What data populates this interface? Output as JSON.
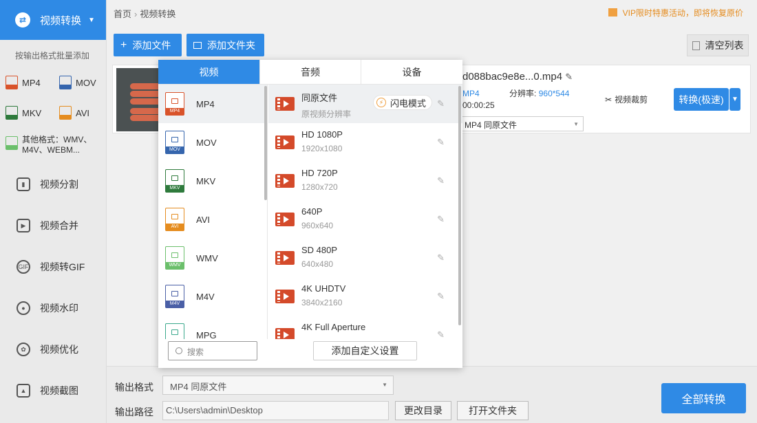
{
  "sidebar": {
    "header": "视频转换",
    "subtitle": "按输出格式批量添加",
    "formats": [
      "MP4",
      "MOV",
      "MKV",
      "AVI"
    ],
    "format_colors": [
      "#d9532a",
      "#3565ad",
      "#2e7a3c",
      "#e58c1f"
    ],
    "other_formats": "其他格式：WMV、M4V、WEBM...",
    "menu": [
      "视频分割",
      "视频合并",
      "视频转GIF",
      "视频水印",
      "视频优化",
      "视频截图"
    ]
  },
  "breadcrumb": {
    "home": "首页",
    "current": "视频转换"
  },
  "vip_notice": "VIP限时特惠活动，即将恢复原价",
  "toolbar": {
    "add_file": "添加文件",
    "add_folder": "添加文件夹",
    "clear_list": "清空列表"
  },
  "file": {
    "name": "d088bac9e8e...0.mp4",
    "format": "MP4",
    "resolution_label": "分辨率:",
    "resolution": "960*544",
    "duration": "00:00:25",
    "output_format": "MP4  同原文件",
    "crop": "视频裁剪",
    "convert": "转换(极速)"
  },
  "popup": {
    "tabs": [
      "视频",
      "音频",
      "设备"
    ],
    "formats": [
      {
        "name": "MP4",
        "color": "#d9532a"
      },
      {
        "name": "MOV",
        "color": "#3565ad"
      },
      {
        "name": "MKV",
        "color": "#2e7a3c"
      },
      {
        "name": "AVI",
        "color": "#e58c1f"
      },
      {
        "name": "WMV",
        "color": "#6bbf6b"
      },
      {
        "name": "M4V",
        "color": "#4a5fa6"
      },
      {
        "name": "MPG",
        "color": "#3aa88c"
      }
    ],
    "search_placeholder": "搜索",
    "presets": [
      {
        "name": "同原文件",
        "res": "原视频分辨率"
      },
      {
        "name": "HD 1080P",
        "res": "1920x1080"
      },
      {
        "name": "HD 720P",
        "res": "1280x720"
      },
      {
        "name": "640P",
        "res": "960x640"
      },
      {
        "name": "SD 480P",
        "res": "640x480"
      },
      {
        "name": "4K UHDTV",
        "res": "3840x2160"
      },
      {
        "name": "4K Full Aperture",
        "res": ""
      }
    ],
    "flash_mode": "闪电模式",
    "custom_settings": "添加自定义设置"
  },
  "bottom": {
    "output_format_label": "输出格式",
    "output_format_value": "MP4  同原文件",
    "output_path_label": "输出路径",
    "output_path_value": "C:\\Users\\admin\\Desktop",
    "change_dir": "更改目录",
    "open_folder": "打开文件夹",
    "convert_all": "全部转换"
  }
}
